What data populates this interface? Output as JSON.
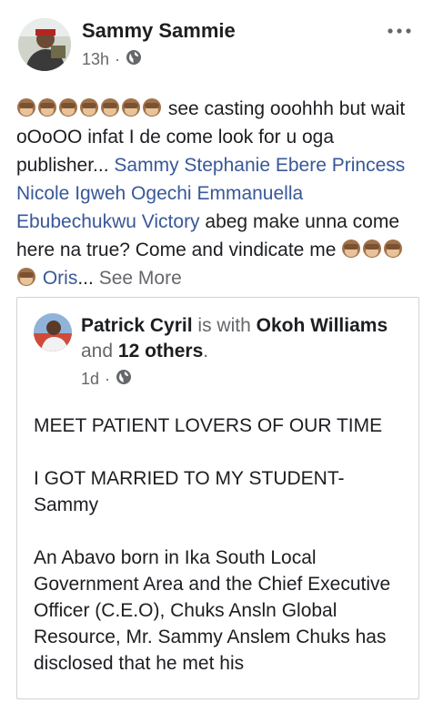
{
  "post": {
    "author": "Sammy Sammie",
    "time": "13h",
    "separator": "·",
    "text_1": " see casting ooohhh but wait oOoOO infat I de come look for u oga publisher... ",
    "mention_1": "Sammy Stephanie Ebere",
    "mention_2": "Princess Nicole Igweh Ogechi",
    "mention_3": "Emmanuella",
    "mention_4": "Ebubechukwu Victory",
    "text_2": " abeg make unna come here na true? Come and vindicate me ",
    "mention_5": "Oris",
    "ellipsis": "...",
    "see_more": "See More",
    "colors": {
      "mention": "#385898",
      "meta": "#65676b",
      "text": "#1c1e21"
    }
  },
  "shared_post": {
    "author": "Patrick Cyril",
    "is_with": "is with",
    "tagged": "Okoh Williams",
    "and_text": "and",
    "others": "12 others",
    "period": ".",
    "time": "1d",
    "separator": "·",
    "paragraphs": [
      "MEET PATIENT LOVERS OF OUR TIME",
      "I GOT MARRIED TO MY STUDENT-Sammy",
      "An Abavo born in Ika South Local Government Area and the Chief Executive Officer (C.E.O), Chuks Ansln Global Resource, Mr. Sammy Anslem Chuks has disclosed that he met his"
    ]
  }
}
